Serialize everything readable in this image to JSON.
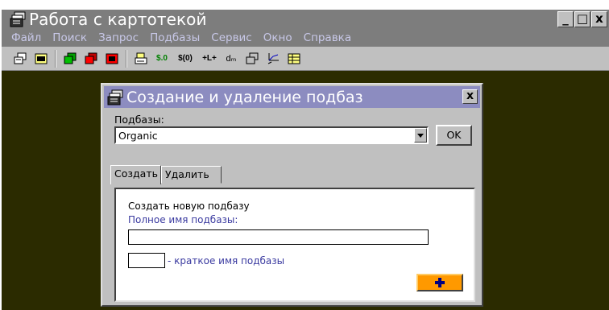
{
  "window": {
    "title": "Работа с картотекой",
    "controls": [
      "_",
      "□",
      "x"
    ]
  },
  "menu": [
    "Файл",
    "Поиск",
    "Запрос",
    "Подбазы",
    "Сервис",
    "Окно",
    "Справка"
  ],
  "toolbar": {
    "text_buttons": {
      "s0": "$.0",
      "s0b": "$(0)",
      "lr": "+L+",
      "dm": "dₘ"
    }
  },
  "dialog": {
    "title": "Создание и удаление подбаз",
    "close": "x",
    "subbases_label": "Подбазы:",
    "selected": "Organic",
    "ok": "OK",
    "tabs": [
      "Создать",
      "Удалить"
    ],
    "create_heading": "Создать новую подбазу",
    "full_name_label": "Полное имя подбазы:",
    "full_name_value": "",
    "short_name_value": "",
    "short_name_label": "- краткое имя подбазы"
  },
  "colors": {
    "title_bar": "#7d7d7d",
    "menu_text": "#c8c8e8",
    "workspace": "#2b2b00",
    "dialog_title": "#8c8cc0",
    "link_text": "#3a3aa0",
    "add_button": "#ff9900"
  }
}
